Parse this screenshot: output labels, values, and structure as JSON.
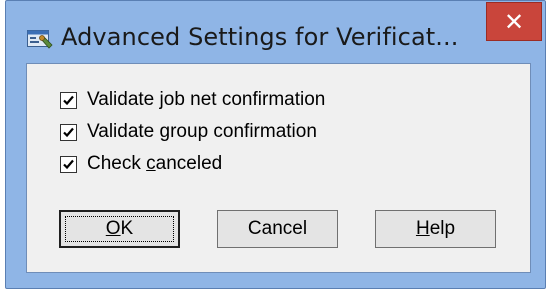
{
  "window": {
    "title": "Advanced Settings for Verificat...",
    "close_glyph": "✕",
    "icon": "settings-window-icon"
  },
  "options": [
    {
      "label_pre": "Validate job net confirmation",
      "label_mnemonic": "",
      "label_post": "",
      "checked": true
    },
    {
      "label_pre": "Validate ",
      "label_mnemonic": "g",
      "label_post": "roup confirmation",
      "checked": true
    },
    {
      "label_pre": "Check ",
      "label_mnemonic": "c",
      "label_post": "anceled",
      "checked": true
    }
  ],
  "buttons": {
    "ok_label": "OK",
    "ok_mnemonic": "O",
    "ok_rest": "K",
    "cancel_label": "Cancel",
    "help_mnemonic": "H",
    "help_rest": "elp"
  },
  "colors": {
    "frame": "#8fb5e6",
    "close_button": "#c9453b",
    "client_background": "#f0f0f0"
  }
}
